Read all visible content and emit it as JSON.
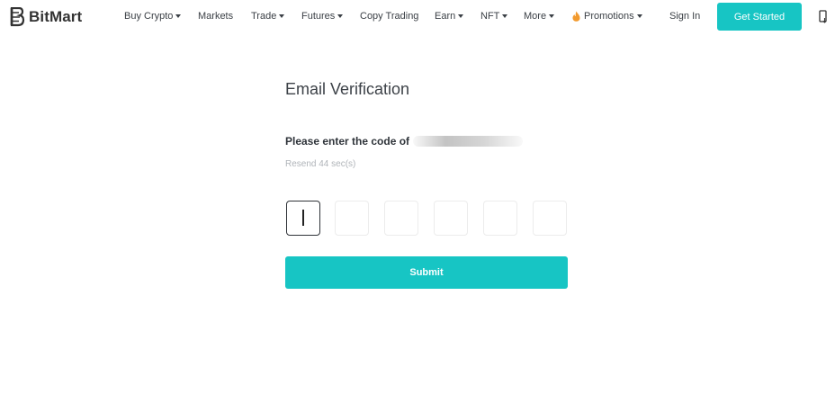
{
  "brand": {
    "name": "BitMart",
    "accent_color": "#17c5c4"
  },
  "nav": {
    "items": [
      {
        "label": "Buy Crypto",
        "has_dropdown": true
      },
      {
        "label": "Markets",
        "has_dropdown": false
      },
      {
        "label": "Trade",
        "has_dropdown": true
      },
      {
        "label": "Futures",
        "has_dropdown": true
      },
      {
        "label": "Copy Trading",
        "has_dropdown": false
      },
      {
        "label": "Earn",
        "has_dropdown": true
      },
      {
        "label": "NFT",
        "has_dropdown": true
      },
      {
        "label": "More",
        "has_dropdown": true
      },
      {
        "label": "Promotions",
        "has_dropdown": true,
        "icon": "flame-icon"
      }
    ],
    "sign_in": "Sign In",
    "get_started": "Get Started",
    "device_icon": "mobile-download-icon"
  },
  "verification": {
    "title": "Email Verification",
    "prompt": "Please enter the code of",
    "email_redacted": true,
    "resend": "Resend 44 sec(s)",
    "code_digits": [
      "",
      "",
      "",
      "",
      "",
      ""
    ],
    "active_digit": 0,
    "submit": "Submit"
  }
}
